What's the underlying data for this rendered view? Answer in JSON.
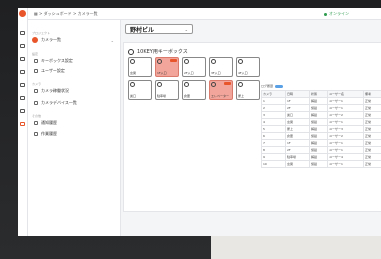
{
  "topbar": {
    "breadcrumb": "▦ > ダッシュボード > カメラ一覧",
    "status": "オンライン"
  },
  "sidebar": {
    "section_project": "プロジェクト",
    "project_name": "カメラ一覧",
    "section_admin": "設定",
    "admin_items": [
      {
        "label": "キーボックス設定"
      },
      {
        "label": "ユーザー設定"
      }
    ],
    "section_camera": "カメラ",
    "camera_items": [
      {
        "label": "カメラ稼働状況"
      },
      {
        "label": "カメラデバイス一覧"
      }
    ],
    "section_other": "その他",
    "other_items": [
      {
        "label": "通知履歴"
      },
      {
        "label": "作業履歴"
      }
    ]
  },
  "main": {
    "site_name": "野村ビル",
    "panel_title": "10KEY用キーボックス",
    "cameras": [
      {
        "label": "玄関"
      },
      {
        "label": "1F入口"
      },
      {
        "label": "2F入口"
      },
      {
        "label": "3F入口"
      },
      {
        "label": "4F入口"
      },
      {
        "label": "裏口"
      },
      {
        "label": "駐車場"
      },
      {
        "label": "倉庫"
      },
      {
        "label": "エレベーター"
      },
      {
        "label": "屋上"
      }
    ],
    "log_title": "ログ履歴",
    "log_columns": [
      "カメラ",
      "日時",
      "状態",
      "ユーザー名",
      "備考"
    ],
    "log_rows": [
      [
        "1",
        "1F",
        "解錠",
        "ユーザー1",
        "正常"
      ],
      [
        "2",
        "2F",
        "施錠",
        "ユーザー1",
        "正常"
      ],
      [
        "3",
        "裏口",
        "解錠",
        "ユーザー2",
        "正常"
      ],
      [
        "4",
        "玄関",
        "施錠",
        "ユーザー1",
        "正常"
      ],
      [
        "5",
        "屋上",
        "解錠",
        "ユーザー3",
        "正常"
      ],
      [
        "6",
        "倉庫",
        "施錠",
        "ユーザー2",
        "正常"
      ],
      [
        "7",
        "1F",
        "解錠",
        "ユーザー1",
        "正常"
      ],
      [
        "8",
        "2F",
        "施錠",
        "ユーザー1",
        "正常"
      ],
      [
        "9",
        "駐車場",
        "解錠",
        "ユーザー4",
        "正常"
      ],
      [
        "10",
        "玄関",
        "施錠",
        "ユーザー1",
        "正常"
      ]
    ]
  },
  "colors": {
    "accent": "#e8552a",
    "alert_tile": "#f2a69b",
    "online": "#2e9b4e",
    "bezel": "#1f2022"
  }
}
